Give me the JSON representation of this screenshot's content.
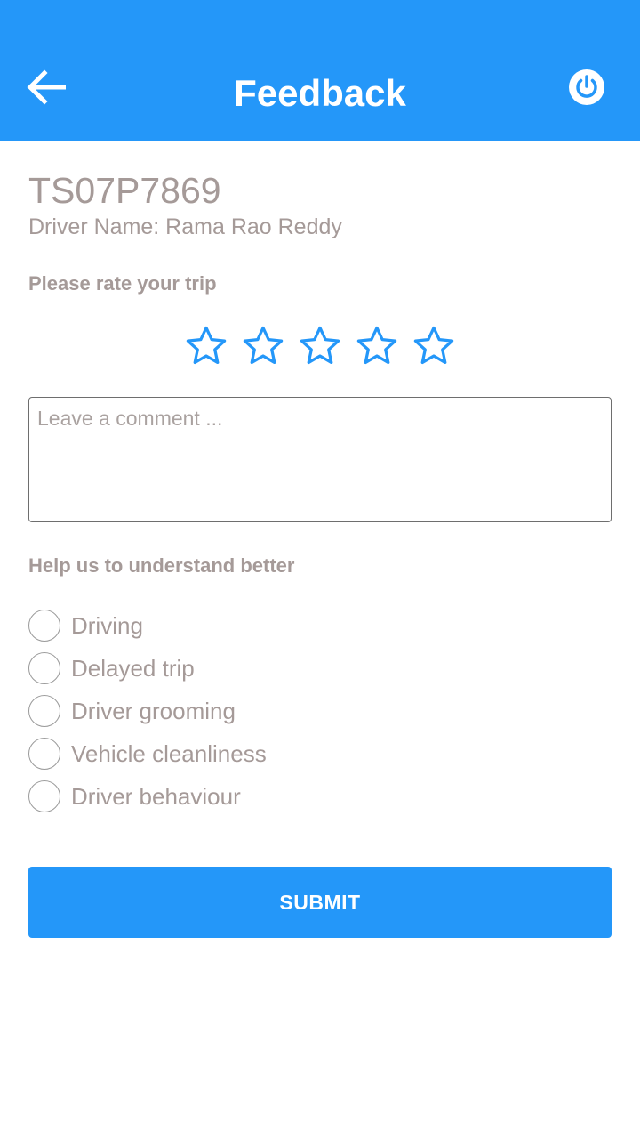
{
  "header": {
    "title": "Feedback",
    "back_icon": "arrow-left-icon",
    "power_icon": "power-icon",
    "background_color": "#2497f9"
  },
  "trip": {
    "vehicle_number": "TS07P7869",
    "driver_line": "Driver Name: Rama Rao Reddy"
  },
  "rating": {
    "label": "Please rate your trip",
    "max_stars": 5,
    "selected": 0,
    "star_color": "#2497f9"
  },
  "comment": {
    "placeholder": "Leave a comment ...",
    "value": ""
  },
  "feedback_options": {
    "label": "Help us to understand better",
    "items": [
      {
        "label": "Driving",
        "checked": false
      },
      {
        "label": "Delayed trip",
        "checked": false
      },
      {
        "label": "Driver grooming",
        "checked": false
      },
      {
        "label": "Vehicle cleanliness",
        "checked": false
      },
      {
        "label": "Driver behaviour",
        "checked": false
      }
    ]
  },
  "submit": {
    "label": "SUBMIT"
  }
}
